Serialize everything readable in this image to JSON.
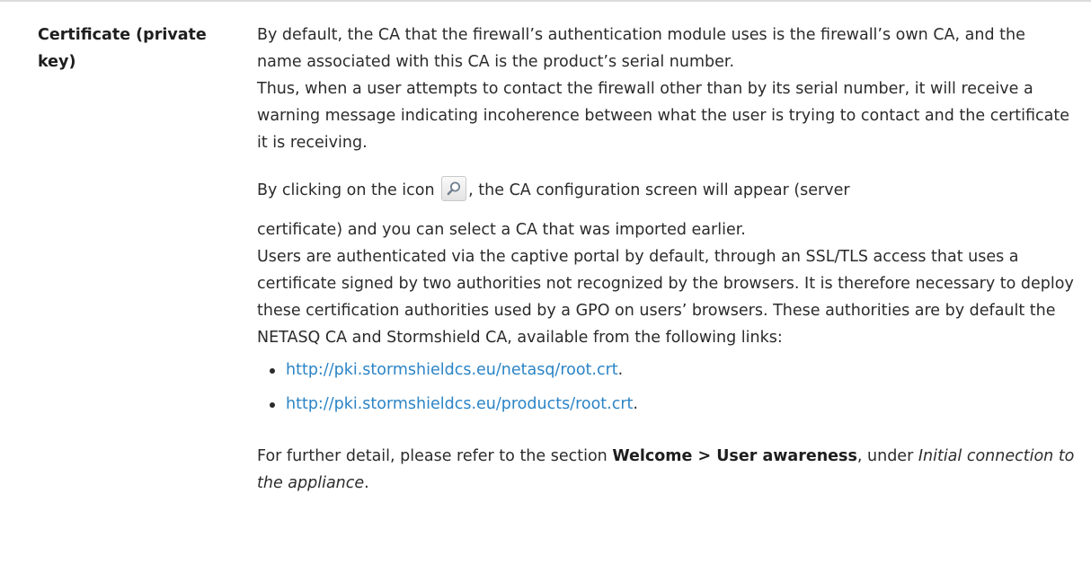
{
  "row": {
    "term": "Certificate (private key)",
    "para1": [
      "By default, the CA that the firewall’s authentication module uses is the firewall’s own CA, and the name associated with this CA is the product’s serial number.",
      "Thus, when a user attempts to contact the firewall other than by its serial number, it will receive a warning message indicating incoherence between what the user is trying to contact and the certificate it is receiving."
    ],
    "icon_line_before": "By clicking on the icon",
    "icon_line_after": ", the CA configuration screen will appear (server",
    "icon_name": "search-icon",
    "para3": "certificate) and you can select a CA that was imported earlier.",
    "para4": "Users are authenticated via the captive portal by default, through an SSL/TLS access that uses a certificate signed by two authorities not recognized by the browsers. It is therefore necessary to deploy these certification authorities used by a GPO on users’ browsers. These authorities are by default the NETASQ CA and Stormshield CA, available from the following links:",
    "links": [
      {
        "text": "http://pki.stormshieldcs.eu/netasq/root.crt",
        "suffix": "."
      },
      {
        "text": "http://pki.stormshieldcs.eu/products/root.crt",
        "suffix": "."
      }
    ],
    "footer": {
      "prefix": "For further detail, please refer to the section ",
      "section": "Welcome > User awareness",
      "middle": ", under ",
      "ref": "Initial connection to the appliance",
      "suffix": "."
    }
  },
  "colors": {
    "link": "#2b84c6",
    "text": "#2b2b2b",
    "rule": "#dcdcdc"
  }
}
